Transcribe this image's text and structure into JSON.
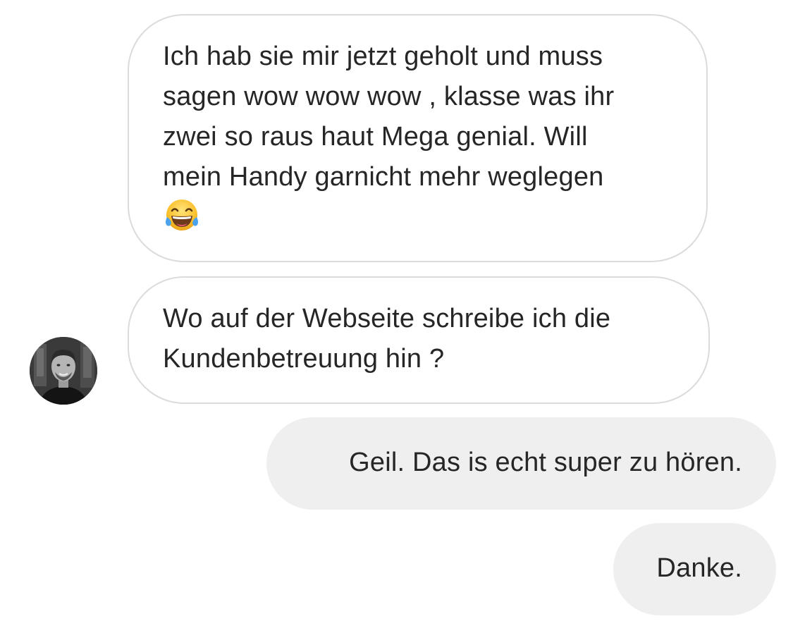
{
  "thread": {
    "messages": [
      {
        "direction": "incoming",
        "lines": [
          "Ich hab sie mir jetzt geholt und muss",
          "sagen wow wow wow , klasse was ihr",
          "zwei so raus haut Mega genial. Will",
          "mein Handy garnicht mehr weglegen"
        ],
        "emoji": "face-with-tears-of-joy-emoji"
      },
      {
        "direction": "incoming",
        "lines": [
          "Wo auf der Webseite schreibe ich die",
          "Kundenbetreuung hin ?"
        ],
        "sender_avatar": "profile-photo"
      },
      {
        "direction": "outgoing",
        "text": "Geil. Das is echt super zu hören."
      },
      {
        "direction": "outgoing",
        "text": "Danke."
      }
    ]
  },
  "colors": {
    "incoming_border": "#dbdbdb",
    "outgoing_background": "#efefef",
    "text": "#262626"
  }
}
